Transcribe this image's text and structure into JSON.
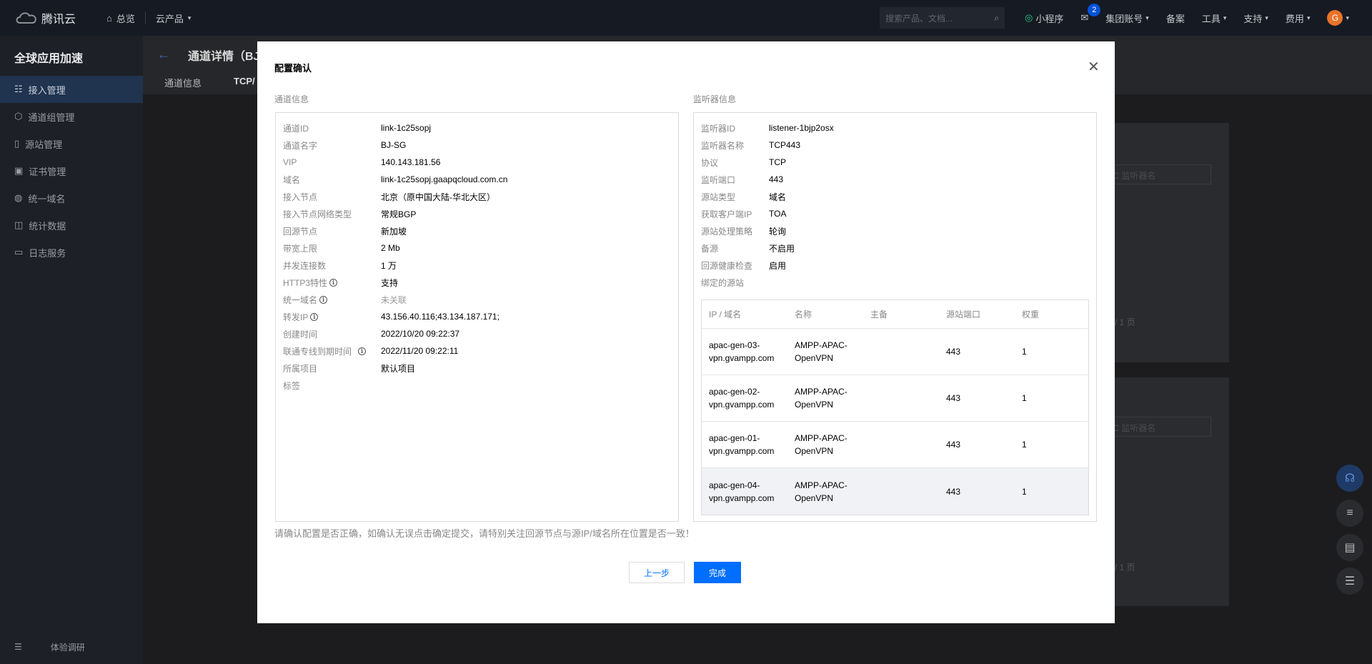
{
  "topbar": {
    "brand": "腾讯云",
    "nav": [
      "总览",
      "云产品"
    ],
    "search_placeholder": "搜索产品、文档...",
    "right_items": [
      "小程序",
      "集团账号",
      "备案",
      "工具",
      "支持",
      "费用"
    ],
    "mail_badge": "2",
    "avatar_letter": "G"
  },
  "sidebar": {
    "title": "全球应用加速",
    "items": [
      {
        "label": "接入管理",
        "icon": "access-icon",
        "active": true
      },
      {
        "label": "通道组管理",
        "icon": "group-icon",
        "active": false
      },
      {
        "label": "源站管理",
        "icon": "origin-icon",
        "active": false
      },
      {
        "label": "证书管理",
        "icon": "certificate-icon",
        "active": false
      },
      {
        "label": "统一域名",
        "icon": "globe-icon",
        "active": false
      },
      {
        "label": "统计数据",
        "icon": "stats-icon",
        "active": false
      },
      {
        "label": "日志服务",
        "icon": "log-icon",
        "active": false
      }
    ],
    "footer_label": "体验调研"
  },
  "page": {
    "title": "通道详情（BJ",
    "tabs": [
      "通道信息",
      "TCP/"
    ],
    "page_indicator": "/ 1 页",
    "search_placeholder": "IC 监听器名"
  },
  "modal": {
    "title": "配置确认",
    "channel_section_label": "通道信息",
    "listener_section_label": "监听器信息",
    "channel_info": [
      {
        "key": "通道ID",
        "value": "link-1c25sopj",
        "info": false,
        "muted": false
      },
      {
        "key": "通道名字",
        "value": "BJ-SG",
        "info": false,
        "muted": false
      },
      {
        "key": "VIP",
        "value": "140.143.181.56",
        "info": false,
        "muted": false
      },
      {
        "key": "域名",
        "value": "link-1c25sopj.gaapqcloud.com.cn",
        "info": false,
        "muted": false
      },
      {
        "key": "接入节点",
        "value": "北京（原中国大陆-华北大区）",
        "info": false,
        "muted": false
      },
      {
        "key": "接入节点网络类型",
        "value": "常规BGP",
        "info": false,
        "muted": false
      },
      {
        "key": "回源节点",
        "value": "新加坡",
        "info": false,
        "muted": false
      },
      {
        "key": "带宽上限",
        "value": "2 Mb",
        "info": false,
        "muted": false
      },
      {
        "key": "并发连接数",
        "value": "1 万",
        "info": false,
        "muted": false
      },
      {
        "key": "HTTP3特性",
        "value": "支持",
        "info": true,
        "muted": false
      },
      {
        "key": "统一域名",
        "value": "未关联",
        "info": true,
        "muted": true
      },
      {
        "key": "转发IP",
        "value": "43.156.40.116;43.134.187.171;",
        "info": true,
        "muted": false
      },
      {
        "key": "创建时间",
        "value": "2022/10/20 09:22:37",
        "info": false,
        "muted": false
      },
      {
        "key": "联通专线到期时间",
        "value": "2022/11/20 09:22:11",
        "info": true,
        "muted": false
      },
      {
        "key": "所属项目",
        "value": "默认项目",
        "info": false,
        "muted": false
      },
      {
        "key": "标签",
        "value": "",
        "info": false,
        "muted": false
      }
    ],
    "listener_info": [
      {
        "key": "监听器ID",
        "value": "listener-1bjp2osx"
      },
      {
        "key": "监听器名称",
        "value": "TCP443"
      },
      {
        "key": "协议",
        "value": "TCP"
      },
      {
        "key": "监听端口",
        "value": "443"
      },
      {
        "key": "源站类型",
        "value": "域名"
      },
      {
        "key": "获取客户端IP",
        "value": "TOA"
      },
      {
        "key": "源站处理策略",
        "value": "轮询"
      },
      {
        "key": "备源",
        "value": "不启用"
      },
      {
        "key": "回源健康检查",
        "value": "启用"
      },
      {
        "key": "绑定的源站",
        "value": ""
      }
    ],
    "origin_table": {
      "headers": [
        "IP / 域名",
        "名称",
        "主备",
        "源站端口",
        "权重"
      ],
      "rows": [
        {
          "host_line1": "apac-gen-03-",
          "host_line2": "vpn.gvampp.com",
          "name_line1": "AMPP-APAC-",
          "name_line2": "OpenVPN",
          "role": "",
          "port": "443",
          "weight": "1"
        },
        {
          "host_line1": "apac-gen-02-",
          "host_line2": "vpn.gvampp.com",
          "name_line1": "AMPP-APAC-",
          "name_line2": "OpenVPN",
          "role": "",
          "port": "443",
          "weight": "1"
        },
        {
          "host_line1": "apac-gen-01-",
          "host_line2": "vpn.gvampp.com",
          "name_line1": "AMPP-APAC-",
          "name_line2": "OpenVPN",
          "role": "",
          "port": "443",
          "weight": "1"
        },
        {
          "host_line1": "apac-gen-04-",
          "host_line2": "vpn.gvampp.com",
          "name_line1": "AMPP-APAC-",
          "name_line2": "OpenVPN",
          "role": "",
          "port": "443",
          "weight": "1"
        }
      ]
    },
    "warning": "请确认配置是否正确，如确认无误点击确定提交，请特别关注回源节点与源IP/域名所在位置是否一致！",
    "prev_label": "上一步",
    "done_label": "完成"
  }
}
